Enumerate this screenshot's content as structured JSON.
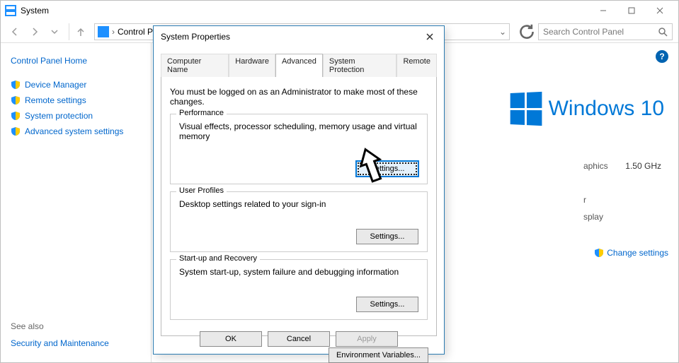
{
  "window": {
    "title": "System"
  },
  "window_controls": {
    "minimize": "–",
    "maximize": "▢",
    "close": "✕"
  },
  "nav": {
    "breadcrumb": "Control Panel",
    "dropdown_glyph": "›",
    "search_placeholder": "Search Control Panel"
  },
  "sidebar": {
    "home": "Control Panel Home",
    "links": [
      {
        "label": "Device Manager"
      },
      {
        "label": "Remote settings"
      },
      {
        "label": "System protection"
      },
      {
        "label": "Advanced system settings"
      }
    ],
    "see_also": "See also",
    "sec_maint": "Security and Maintenance"
  },
  "main": {
    "brand_text": "Windows 10",
    "spec_graphics_label": "aphics",
    "spec_graphics_value": "1.50 GHz",
    "spec_processor_label": "r",
    "spec_display_label": "splay",
    "change_settings": "Change settings",
    "help_glyph": "?"
  },
  "dialog": {
    "title": "System Properties",
    "tabs": [
      "Computer Name",
      "Hardware",
      "Advanced",
      "System Protection",
      "Remote"
    ],
    "active_tab": "Advanced",
    "must_text": "You must be logged on as an Administrator to make most of these changes.",
    "groups": {
      "performance": {
        "legend": "Performance",
        "desc": "Visual effects, processor scheduling, memory usage and virtual memory",
        "button": "Settings..."
      },
      "user_profiles": {
        "legend": "User Profiles",
        "desc": "Desktop settings related to your sign-in",
        "button": "Settings..."
      },
      "startup": {
        "legend": "Start-up and Recovery",
        "desc": "System start-up, system failure and debugging information",
        "button": "Settings..."
      }
    },
    "env_button": "Environment Variables...",
    "ok": "OK",
    "cancel": "Cancel",
    "apply": "Apply"
  }
}
